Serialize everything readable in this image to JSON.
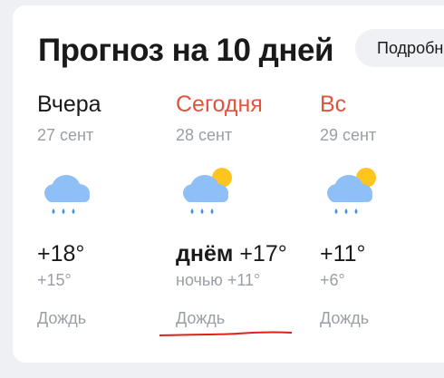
{
  "header": {
    "title": "Прогноз на 10 дней",
    "more_label": "Подробно"
  },
  "days": [
    {
      "name": "Вчера",
      "date": "27 сент",
      "day_prefix": "",
      "day_temp": "+18°",
      "night_prefix": "",
      "night_temp": "+15°",
      "condition": "Дождь",
      "icon": "rain-cloud-icon"
    },
    {
      "name": "Сегодня",
      "date": "28 сент",
      "day_prefix": "днём",
      "day_temp": "+17°",
      "night_prefix": "ночью",
      "night_temp": "+11°",
      "condition": "Дождь",
      "icon": "rain-cloud-sun-icon"
    },
    {
      "name": "Вс",
      "date": "29 сент",
      "day_prefix": "",
      "day_temp": "+11°",
      "night_prefix": "",
      "night_temp": "+6°",
      "condition": "Дождь",
      "icon": "rain-cloud-sun-icon"
    }
  ],
  "colors": {
    "accent_red": "#e0533d",
    "muted_text": "#9a9ea6",
    "cloud_blue": "#8fbff7",
    "drop_blue": "#4a90e2",
    "sun_yellow": "#ffc51f"
  }
}
